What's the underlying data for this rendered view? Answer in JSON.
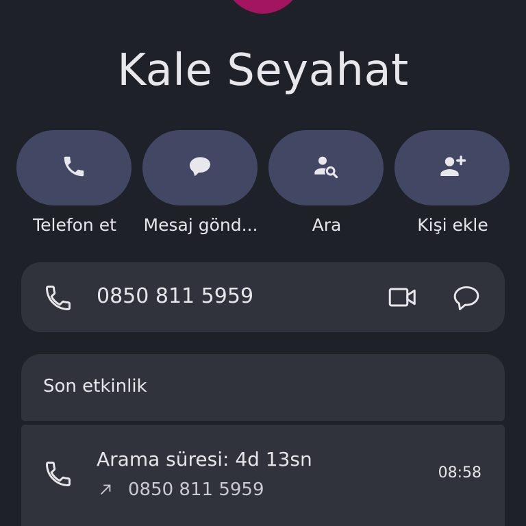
{
  "contact": {
    "name": "Kale Seyahat",
    "avatar_color": "#a3155f"
  },
  "actions": [
    {
      "label": "Telefon et",
      "icon": "phone-icon"
    },
    {
      "label": "Mesaj gönd...",
      "icon": "message-icon"
    },
    {
      "label": "Ara",
      "icon": "search-person-icon"
    },
    {
      "label": "Kişi ekle",
      "icon": "add-person-icon"
    }
  ],
  "phone_entry": {
    "number": "0850 811 5959",
    "icons": [
      "phone-icon",
      "video-call-icon",
      "message-icon"
    ]
  },
  "activity": {
    "title": "Son etkinlik",
    "items": [
      {
        "title": "Arama süresi: 4d 13sn",
        "number": "0850 811 5959",
        "time": "08:58",
        "icon": "phone-icon",
        "direction_icon": "outgoing-arrow-icon"
      }
    ]
  },
  "colors": {
    "background": "#1f2128",
    "card": "#31333c",
    "action_pill": "#424863",
    "text": "#e6e6ea"
  }
}
